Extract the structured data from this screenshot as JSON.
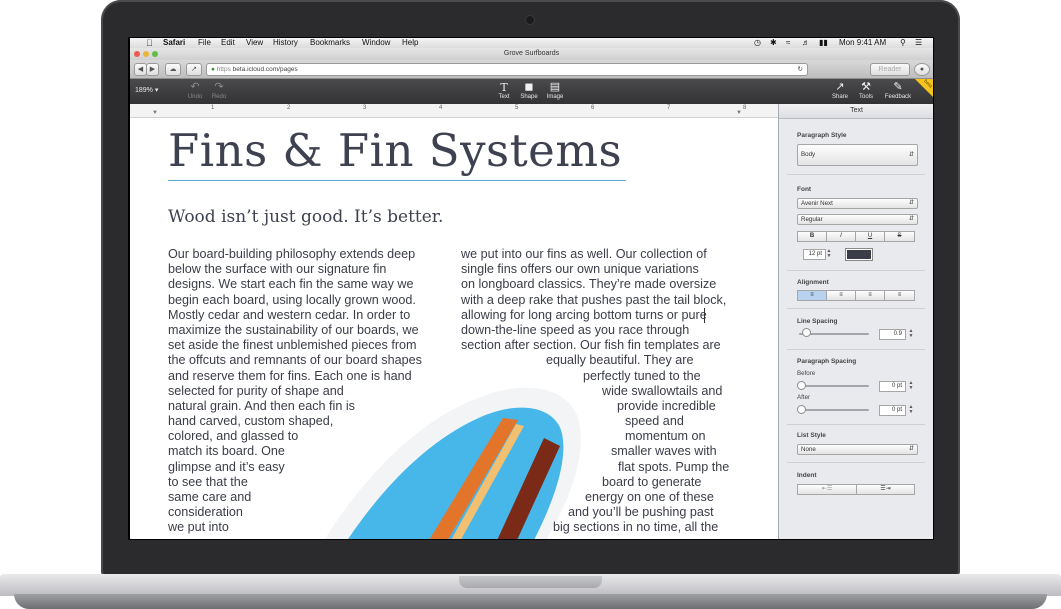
{
  "menubar": {
    "app": "Safari",
    "items": [
      "File",
      "Edit",
      "View",
      "History",
      "Bookmarks",
      "Window",
      "Help"
    ],
    "clock": "Mon 9:41 AM"
  },
  "window": {
    "title": "Grove Surfboards"
  },
  "safari": {
    "url": "beta.icloud.com/pages",
    "protocol": "https",
    "reader_label": "Reader"
  },
  "pages_toolbar": {
    "zoom": "189%",
    "undo": "Undo",
    "redo": "Redo",
    "text": "Text",
    "shape": "Shape",
    "image": "Image",
    "share": "Share",
    "tools": "Tools",
    "feedback": "Feedback",
    "beta": "beta"
  },
  "ruler": {
    "ticks": [
      "1",
      "2",
      "3",
      "4",
      "5",
      "6",
      "7",
      "8"
    ]
  },
  "document": {
    "heading": "Fins & Fin Systems",
    "subheading": "Wood isn’t just good. It’s better.",
    "column1": [
      "Our board-building philosophy extends deep",
      "below the surface with our signature fin",
      "designs. We start each fin the same way we",
      "begin each board, using locally grown wood.",
      "Mostly cedar and western cedar. In order to",
      "maximize the sustainability of our boards, we",
      "set aside the finest unblemished pieces from",
      "the offcuts and remnants of our board shapes",
      "and reserve them for fins. Each one is hand",
      "selected for purity of shape and",
      "natural grain. And then each fin is",
      "hand carved, custom shaped,",
      "colored, and glassed to",
      "match its board. One",
      "glimpse and it’s easy",
      "to see that the",
      "same care and",
      "consideration",
      "we put into"
    ],
    "column2": [
      "we put into our fins as well. Our collection of",
      "single fins offers our own unique variations",
      "on longboard classics. They’re made oversize",
      "with a deep rake that pushes past the tail block,",
      "allowing for long arcing bottom turns or pure",
      "down-the-line speed as you race through",
      "section after section. Our fish fin templates are",
      "equally beautiful. They are",
      "perfectly tuned to the",
      "wide swallowtails and",
      "provide incredible",
      "speed and",
      "momentum on",
      "smaller waves with",
      "flat spots. Pump the",
      "board to generate",
      "energy on one of these",
      "and you’ll be pushing past",
      "big sections in no time, all the"
    ]
  },
  "inspector": {
    "title": "Text",
    "paragraph_style_label": "Paragraph Style",
    "paragraph_style_value": "Body",
    "font_label": "Font",
    "font_family": "Avenir Next",
    "font_weight": "Regular",
    "style_buttons": [
      "B",
      "I",
      "U",
      "S"
    ],
    "font_size": "12 pt",
    "text_color": "#3a3d48",
    "alignment_label": "Alignment",
    "line_spacing_label": "Line Spacing",
    "line_spacing_value": "0.9",
    "paragraph_spacing_label": "Paragraph Spacing",
    "before_label": "Before",
    "before_value": "0 pt",
    "after_label": "After",
    "after_value": "0 pt",
    "list_style_label": "List Style",
    "list_style_value": "None",
    "indent_label": "Indent"
  }
}
